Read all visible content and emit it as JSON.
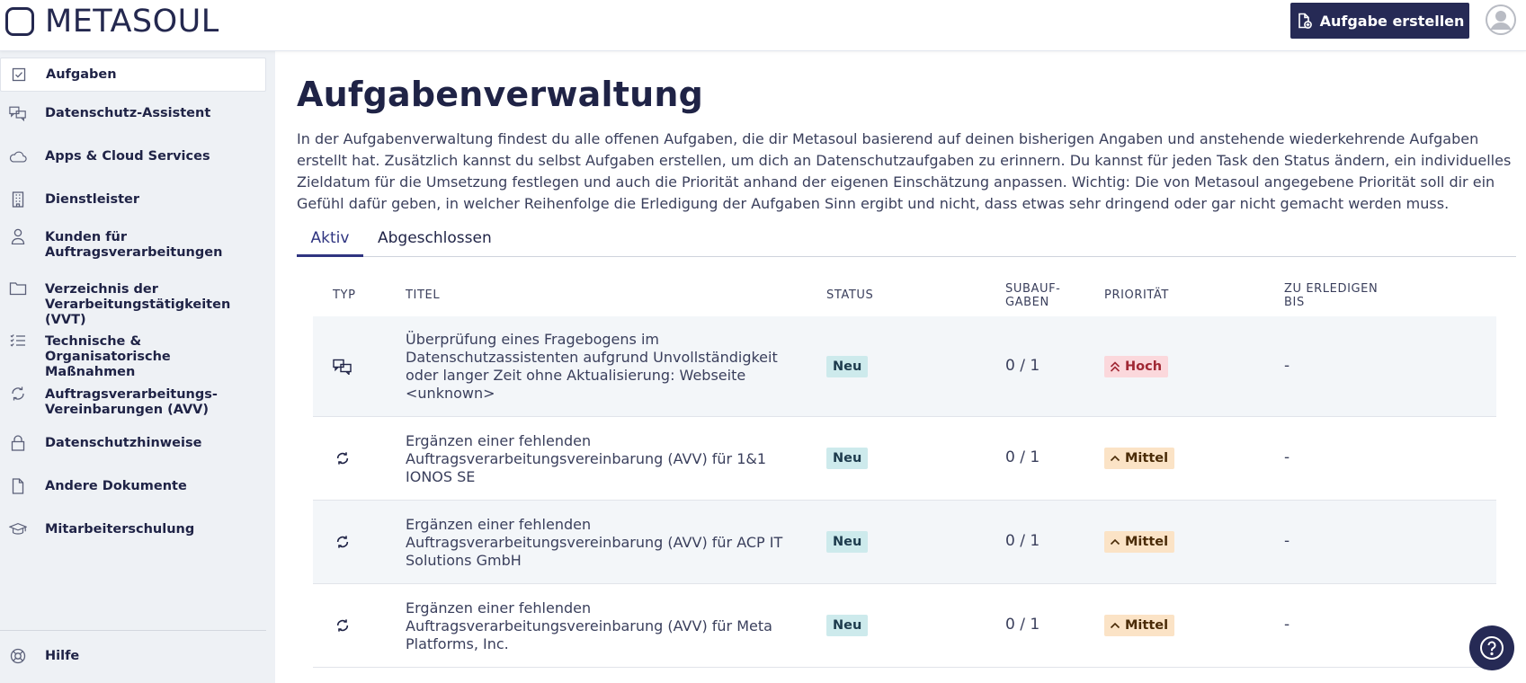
{
  "app": {
    "logo_text": "METASOUL"
  },
  "header": {
    "create_button_label": "Aufgabe erstellen"
  },
  "sidebar": {
    "items": [
      {
        "label": "Aufgaben",
        "icon": "checkbox-icon",
        "active": true
      },
      {
        "label": "Datenschutz-Assistent",
        "icon": "chat-bubbles-icon"
      },
      {
        "label": "Apps & Cloud Services",
        "icon": "cloud-icon"
      },
      {
        "label": "Dienstleister",
        "icon": "building-icon"
      },
      {
        "label": "Kunden für Auftragsverarbeitungen",
        "icon": "person-icon"
      },
      {
        "label": "Verzeichnis der Verarbeitungstätigkeiten (VVT)",
        "icon": "folder-icon"
      },
      {
        "label": "Technische & Organisatorische Maßnahmen",
        "icon": "checklist-icon"
      },
      {
        "label": "Auftragsverarbeitungs-Vereinbarungen (AVV)",
        "icon": "sync-icon"
      },
      {
        "label": "Datenschutzhinweise",
        "icon": "lock-icon"
      },
      {
        "label": "Andere Dokumente",
        "icon": "document-icon"
      },
      {
        "label": "Mitarbeiterschulung",
        "icon": "graduation-cap-icon"
      }
    ],
    "help_label": "Hilfe"
  },
  "main": {
    "title": "Aufgabenverwaltung",
    "intro": "In der Aufgabenverwaltung findest du alle offenen Aufgaben, die dir Metasoul basierend auf deinen bisherigen Angaben und anstehende wiederkehrende Aufgaben erstellt hat. Zusätzlich kannst du selbst Aufgaben erstellen, um dich an Datenschutzaufgaben zu erinnern. Du kannst für jeden Task den Status ändern, ein individuelles Zieldatum für die Umsetzung festlegen und auch die Priorität anhand der eigenen Einschätzung anpassen. Wichtig: Die von Metasoul angegebene Priorität soll dir ein Gefühl dafür geben, in welcher Reihenfolge die Erledigung der Aufgaben Sinn ergibt und nicht, dass etwas sehr dringend oder gar nicht gemacht werden muss.",
    "tabs": [
      {
        "label": "Aktiv",
        "active": true
      },
      {
        "label": "Abgeschlossen"
      }
    ]
  },
  "table": {
    "columns": {
      "type": "TYP",
      "title": "TITEL",
      "status": "STATUS",
      "subtasks_line1": "SUBAUF-",
      "subtasks_line2": "GABEN",
      "priority": "PRIORITÄT",
      "due_line1": "ZU ERLEDIGEN",
      "due_line2": "BIS"
    },
    "rows": [
      {
        "type_icon": "chat-bubbles-icon",
        "title": "Überprüfung eines Fragebogens im Datenschutzassistenten aufgrund Unvollständigkeit oder langer Zeit ohne Aktualisierung: Webseite <unknown>",
        "status": "Neu",
        "subtasks": "0 / 1",
        "priority": "Hoch",
        "priority_level": "high",
        "due": "-"
      },
      {
        "type_icon": "sync-icon",
        "title": "Ergänzen einer fehlenden Auftragsverarbeitungsvereinbarung (AVV) für   1&1 IONOS SE",
        "status": "Neu",
        "subtasks": "0 / 1",
        "priority": "Mittel",
        "priority_level": "medium",
        "due": "-"
      },
      {
        "type_icon": "sync-icon",
        "title": "Ergänzen einer fehlenden Auftragsverarbeitungsvereinbarung (AVV) für ACP IT Solutions GmbH",
        "status": "Neu",
        "subtasks": "0 / 1",
        "priority": "Mittel",
        "priority_level": "medium",
        "due": "-"
      },
      {
        "type_icon": "sync-icon",
        "title": "Ergänzen einer fehlenden Auftragsverarbeitungsvereinbarung (AVV) für Meta Platforms, Inc.",
        "status": "Neu",
        "subtasks": "0 / 1",
        "priority": "Mittel",
        "priority_level": "medium",
        "due": "-"
      }
    ]
  },
  "colors": {
    "brand": "#262a55",
    "sidebar_bg": "#eef1f5",
    "badge_new_bg": "#cdeaec",
    "prio_high_bg": "#fbd8dc",
    "prio_medium_bg": "#fbe3c6"
  }
}
